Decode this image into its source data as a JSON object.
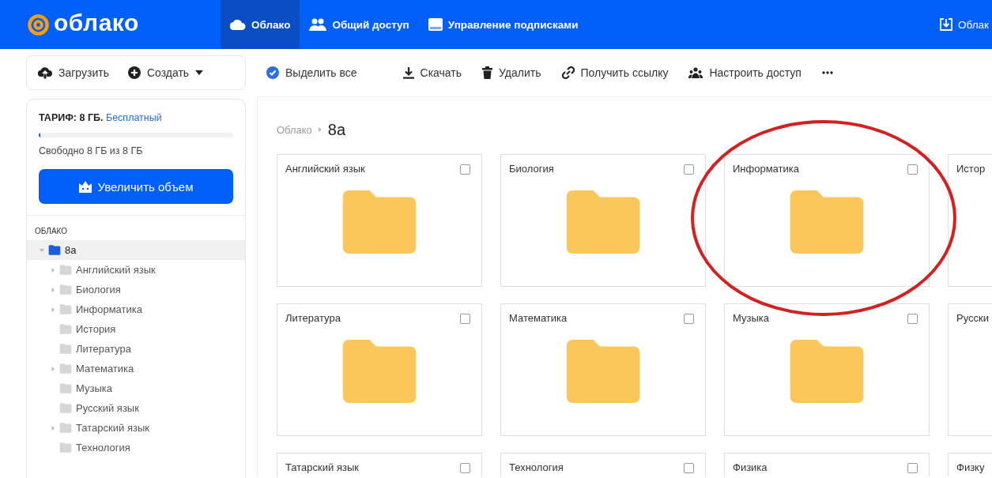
{
  "header": {
    "logo": "облако",
    "tabs": [
      {
        "label": "Облако",
        "selected": true,
        "kind": "cloud"
      },
      {
        "label": "Общий доступ",
        "selected": false,
        "kind": "people"
      },
      {
        "label": "Управление подписками",
        "selected": false,
        "kind": "card"
      }
    ],
    "right_link": "Облак"
  },
  "toolbar": {
    "upload": "Загрузить",
    "create": "Создать",
    "actions": [
      {
        "label": "Выделить все",
        "kind": "select"
      },
      {
        "label": "Скачать",
        "kind": "download"
      },
      {
        "label": "Удалить",
        "kind": "delete"
      },
      {
        "label": "Получить ссылку",
        "kind": "link"
      },
      {
        "label": "Настроить доступ",
        "kind": "access"
      }
    ]
  },
  "sidebar": {
    "plan_label": "ТАРИФ: 8 ГБ.",
    "plan_name": "Бесплатный",
    "storage": {
      "level": 0.01
    },
    "free_text": "Свободно 8 ГБ из 8 ГБ",
    "upgrade_button": "Увеличить объем",
    "section": "ОБЛАКО",
    "tree": [
      {
        "label": "8а",
        "expanded": true,
        "selected": true,
        "children": [
          {
            "label": "Английский язык",
            "expandable": true
          },
          {
            "label": "Биология",
            "expandable": true
          },
          {
            "label": "Информатика",
            "expandable": true
          },
          {
            "label": "История",
            "expandable": false
          },
          {
            "label": "Литература",
            "expandable": false
          },
          {
            "label": "Математика",
            "expandable": true
          },
          {
            "label": "Музыка",
            "expandable": false
          },
          {
            "label": "Русский язык",
            "expandable": false
          },
          {
            "label": "Татарский язык",
            "expandable": true
          },
          {
            "label": "Технология",
            "expandable": false
          }
        ]
      }
    ]
  },
  "breadcrumb": [
    "Облако",
    "8а"
  ],
  "folders": [
    {
      "name": "Английский язык",
      "checked": false
    },
    {
      "name": "Биология",
      "checked": false
    },
    {
      "name": "Информатика",
      "checked": false
    },
    {
      "name": "Истор"
    },
    {
      "name": "Литература",
      "checked": false
    },
    {
      "name": "Математика",
      "checked": false
    },
    {
      "name": "Музыка",
      "checked": false
    },
    {
      "name": "Русски"
    },
    {
      "name": "Татарский язык",
      "checked": false
    },
    {
      "name": "Технология",
      "checked": false
    },
    {
      "name": "Физика",
      "checked": false
    },
    {
      "name": "Физку"
    }
  ]
}
